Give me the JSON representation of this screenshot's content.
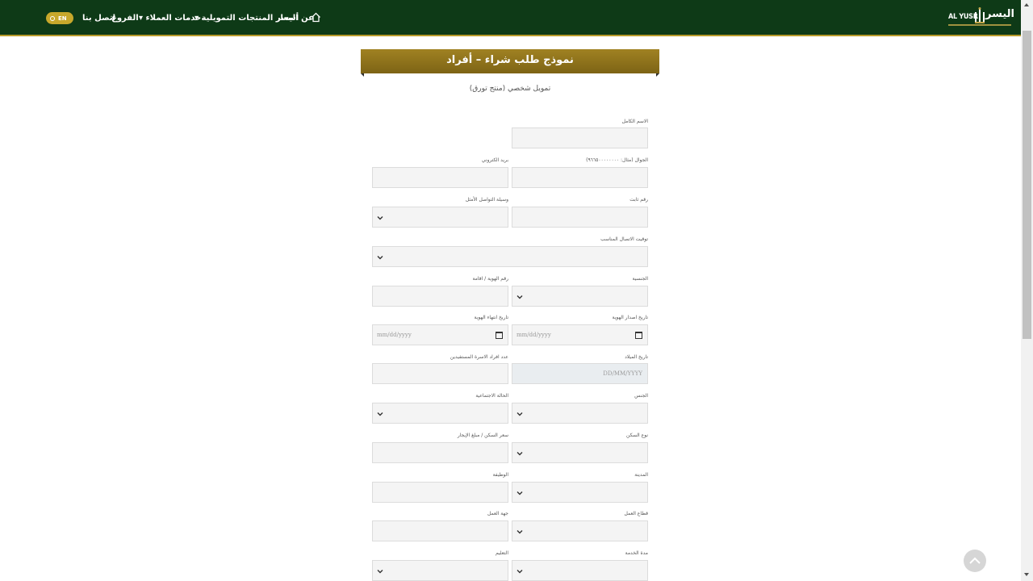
{
  "header": {
    "logo_en": "AL YUSR",
    "logo_ar": "اليسر",
    "nav": {
      "about": "عن اليسر",
      "prices": "أسعار المنتجات التمويلية",
      "services": "خدمات العملاء",
      "branches": "الفروع",
      "contact": "اتصل بنا"
    },
    "lang": "EN"
  },
  "form": {
    "title": "نموذج طلب شراء – أفراد",
    "subtitle": "تمويل شخصي (منتج تورق)",
    "labels": {
      "full_name": "الاسم الكامل",
      "mobile": "الجوال (مثال: ٩٦٦٥٠٠٠٠٠٠٠٠)",
      "email": "بريد الكتروني",
      "landline": "رقم ثابت",
      "contact_method": "وسيلة التواصل الأمثل",
      "contact_time": "توقيت الاتصال المناسب",
      "nationality": "الجنسية",
      "id_number": "رقم الهوية / اقامة",
      "id_issue_date": "تاريخ اصدار الهوية",
      "id_expiry_date": "تاريخ انتهاء الهوية",
      "birth_date": "تاريخ الميلاد",
      "dependents": "عدد افراد الاسرة المستفيدين",
      "gender": "الجنس",
      "marital_status": "الحالة الاجتماعية",
      "housing_type": "نوع السكن",
      "housing_price": "سعر السكن / مبلغ الإيجار",
      "city": "المدينة",
      "job": "الوظيفة",
      "employer_sector": "قطاع العمل",
      "employer": "جهة العمل",
      "service_length": "مدة الخدمة",
      "education": "التعليم"
    },
    "placeholders": {
      "date": "mm/dd/yyyy",
      "dob": "DD/MM/YYYY"
    }
  },
  "colors": {
    "header_bg": "#0e3a17",
    "gold": "#a08222",
    "field_bg": "#f4f4f4"
  },
  "icons": {
    "home": "home-icon",
    "select": "chevron-down-icon",
    "calendar": "calendar-icon",
    "back_to_top": "chevron-up-icon"
  }
}
